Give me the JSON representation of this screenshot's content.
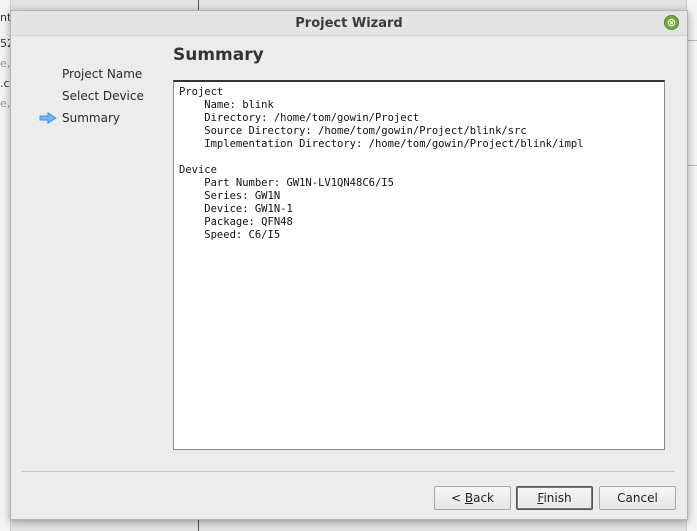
{
  "background": {
    "fragments": [
      "nt",
      "52",
      "e,",
      ".c",
      "e,"
    ]
  },
  "dialog": {
    "title": "Project Wizard",
    "close_glyph": "⊗",
    "heading": "Summary",
    "steps": [
      {
        "label": "Project Name",
        "current": false
      },
      {
        "label": "Select Device",
        "current": false
      },
      {
        "label": "Summary",
        "current": true
      }
    ],
    "summary_lines": [
      "Project",
      "    Name: blink",
      "    Directory: /home/tom/gowin/Project",
      "    Source Directory: /home/tom/gowin/Project/blink/src",
      "    Implementation Directory: /home/tom/gowin/Project/blink/impl",
      "",
      "Device",
      "    Part Number: GW1N-LV1QN48C6/I5",
      "    Series: GW1N",
      "    Device: GW1N-1",
      "    Package: QFN48",
      "    Speed: C6/I5"
    ],
    "buttons": {
      "back": {
        "mnemonic": "B",
        "rest": "ack",
        "prefix": "< "
      },
      "finish": {
        "mnemonic": "F",
        "rest": "inish",
        "prefix": ""
      },
      "cancel": {
        "label": "Cancel"
      }
    },
    "colors": {
      "arrow": "#3f8fd8",
      "close": "#7aa83d"
    }
  }
}
